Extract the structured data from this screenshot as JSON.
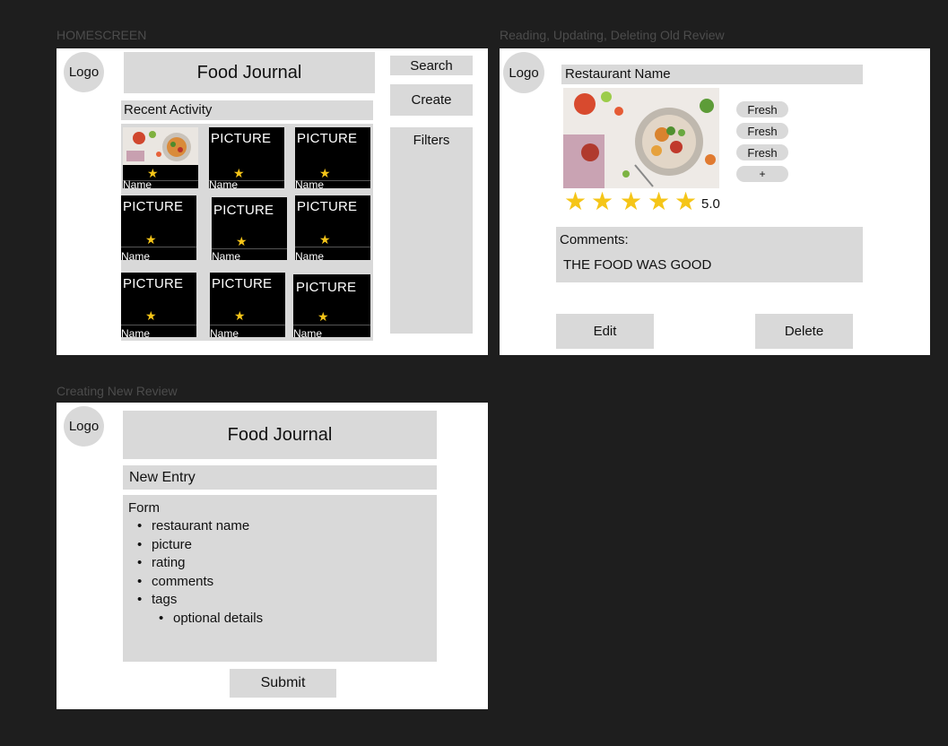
{
  "frames": {
    "home_label": "HOMESCREEN",
    "read_label": "Reading, Updating, Deleting Old Review",
    "create_label": "Creating New Review"
  },
  "home": {
    "logo": "Logo",
    "title": "Food Journal",
    "search": "Search",
    "create": "Create",
    "filters": "Filters",
    "recent_activity": "Recent Activity",
    "items": [
      {
        "text": "",
        "name": "Name"
      },
      {
        "text": "PICTURE",
        "name": "Name"
      },
      {
        "text": "PICTURE",
        "name": "Name"
      },
      {
        "text": "PICTURE",
        "name": "Name"
      },
      {
        "text": "PICTURE",
        "name": "Name"
      },
      {
        "text": "PICTURE",
        "name": "Name"
      },
      {
        "text": "PICTURE",
        "name": "Name"
      },
      {
        "text": "PICTURE",
        "name": "Name"
      },
      {
        "text": "PICTURE",
        "name": "Name"
      }
    ],
    "star": "★"
  },
  "review": {
    "logo": "Logo",
    "restaurant_name": "Restaurant Name",
    "tags": [
      "Fresh",
      "Fresh",
      "Fresh",
      "+"
    ],
    "stars": [
      "★",
      "★",
      "★",
      "★",
      "★"
    ],
    "rating": "5.0",
    "rating_value": 5,
    "comments_label": "Comments:",
    "comment_text": "THE FOOD WAS GOOD",
    "edit": "Edit",
    "delete": "Delete"
  },
  "create": {
    "logo": "Logo",
    "title": "Food Journal",
    "new_entry": "New Entry",
    "form_label": "Form",
    "form_items": [
      "restaurant name",
      "picture",
      "rating",
      "comments",
      "tags"
    ],
    "sub_items": [
      "optional details"
    ],
    "submit": "Submit"
  },
  "colors": {
    "background": "#1e1e1e",
    "frame": "#ffffff",
    "placeholder": "#d9d9d9",
    "star": "#f5c518",
    "picture": "#000000"
  }
}
